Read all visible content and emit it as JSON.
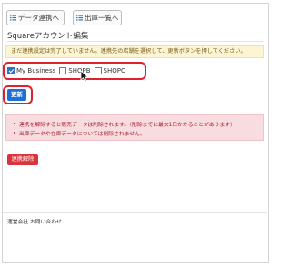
{
  "toolbar": {
    "data_list_label": "データ連携へ",
    "shipments_list_label": "出庫一覧へ"
  },
  "page": {
    "title": "Squareアカウント編集"
  },
  "notice": {
    "text": "まだ連携設定は完了していません。連携先の店舗を選択して、更新ボタンを押してください。"
  },
  "stores": [
    {
      "label": "My Business",
      "checked": true
    },
    {
      "label": "SHOPB",
      "checked": false
    },
    {
      "label": "SHOPC",
      "checked": false
    }
  ],
  "actions": {
    "update_label": "更新",
    "disconnect_label": "連携解除"
  },
  "warning": {
    "items": [
      "連携を解除すると販売データは削除されます。（削除までに最大1日かかることがあります）",
      "出庫データや在庫データについては削除されません。"
    ]
  },
  "footer": {
    "company_label": "運営会社",
    "contact_label": "お問い合わせ"
  },
  "colors": {
    "accent": "#1d6fd6",
    "danger": "#d9343e",
    "highlight_outline": "#e0202e",
    "notice_bg": "#fcf4d3",
    "warning_bg": "#f9dcdf"
  }
}
